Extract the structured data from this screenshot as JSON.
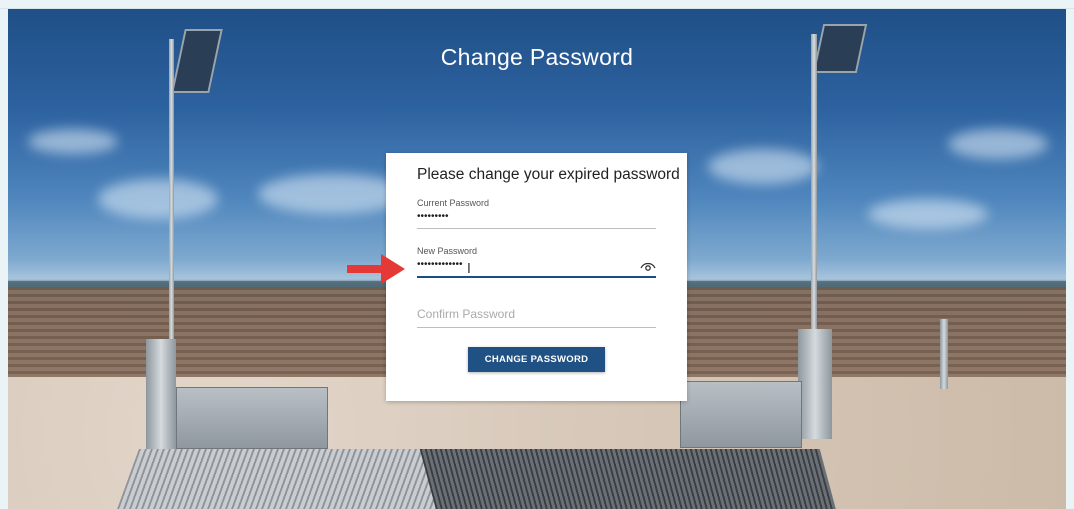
{
  "page": {
    "title": "Change Password"
  },
  "form": {
    "heading": "Please change your expired password",
    "current_password": {
      "label": "Current Password",
      "value": "•••••••••"
    },
    "new_password": {
      "label": "New Password",
      "value": "•••••••••••••"
    },
    "confirm_password": {
      "placeholder": "Confirm Password",
      "value": ""
    },
    "submit_label": "CHANGE PASSWORD"
  },
  "colors": {
    "accent": "#1f5185",
    "annotation_arrow": "#e53935",
    "card_background": "#ffffff"
  },
  "icons": {
    "password_visibility": "eye-icon",
    "text_cursor": "i-beam-cursor-icon",
    "annotation": "arrow-right-icon"
  }
}
